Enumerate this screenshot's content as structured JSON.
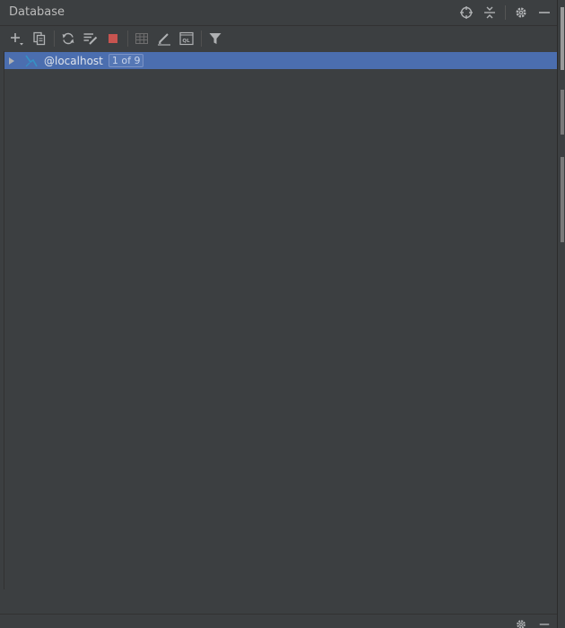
{
  "panel": {
    "title": "Database"
  },
  "header_actions": [
    {
      "icon": "crosshair-icon",
      "name": "locate-button"
    },
    {
      "icon": "collapse-icon",
      "name": "collapse-all-button"
    },
    {
      "icon": "gear-icon",
      "name": "settings-button"
    },
    {
      "icon": "minimize-icon",
      "name": "hide-button"
    }
  ],
  "toolbar": {
    "items": [
      {
        "icon": "plus-icon",
        "name": "new-button"
      },
      {
        "icon": "duplicate-icon",
        "name": "duplicate-button"
      },
      {
        "icon": "refresh-icon",
        "name": "refresh-button"
      },
      {
        "icon": "schema-edit-icon",
        "name": "properties-button"
      },
      {
        "icon": "stop-icon",
        "name": "disconnect-button"
      },
      {
        "icon": "table-icon",
        "name": "table-view-button"
      },
      {
        "icon": "pencil-icon",
        "name": "edit-button"
      },
      {
        "icon": "console-icon",
        "name": "console-button"
      },
      {
        "icon": "filter-icon",
        "name": "filter-button"
      }
    ]
  },
  "tree": {
    "root": {
      "label": "@localhost",
      "badge": "1 of 9",
      "expanded": false,
      "selected": true
    }
  },
  "colors": {
    "background": "#3c3f41",
    "selection": "#4b6eaf",
    "stop": "#c75450",
    "db_icon": "#3592c4"
  }
}
